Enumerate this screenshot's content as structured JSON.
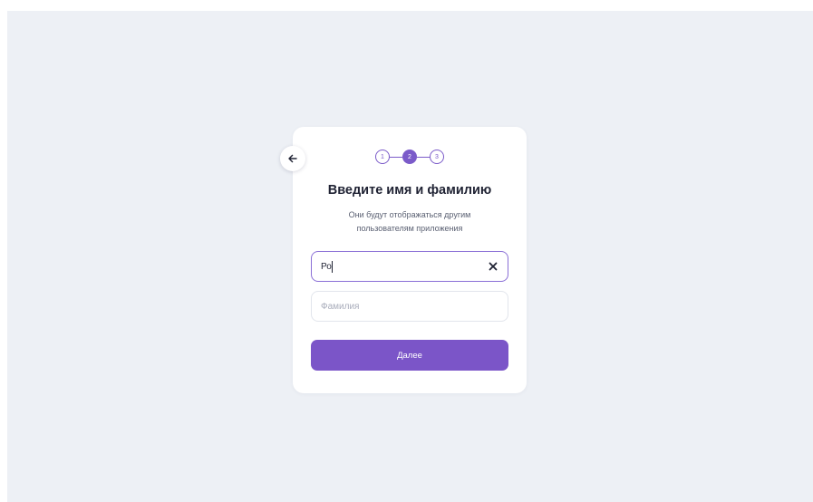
{
  "stepper": {
    "steps": [
      "1",
      "2",
      "3"
    ],
    "current": 2
  },
  "form": {
    "title": "Введите имя и фамилию",
    "subtitle_line1": "Они будут отображаться другим",
    "subtitle_line2": "пользователям приложения",
    "first_name": {
      "value": "Ро",
      "placeholder": ""
    },
    "last_name": {
      "value": "",
      "placeholder": "Фамилия"
    },
    "submit_label": "Далее"
  },
  "icons": {
    "back": "arrow-left-icon",
    "clear": "close-icon"
  },
  "colors": {
    "accent": "#7b55c8",
    "background": "#edf0f5",
    "card": "#ffffff",
    "text": "#1f2233"
  }
}
